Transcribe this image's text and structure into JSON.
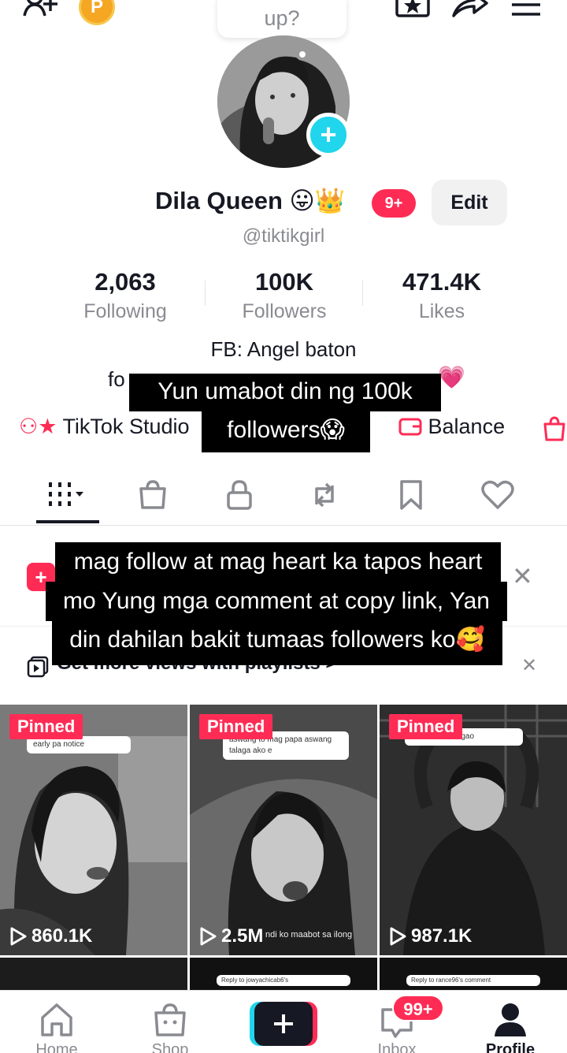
{
  "top": {
    "coin_letter": "P",
    "bubble_text": "up?"
  },
  "profile": {
    "name": "Dila Queen 😛👑",
    "notif_badge": "9+",
    "edit_label": "Edit",
    "handle": "@tiktikgirl"
  },
  "stats": [
    {
      "value": "2,063",
      "label": "Following"
    },
    {
      "value": "100K",
      "label": "Followers"
    },
    {
      "value": "471.4K",
      "label": "Likes"
    }
  ],
  "bio": {
    "line1": "FB: Angel baton",
    "line2_start": "fo",
    "line2_end": "💗"
  },
  "captions": {
    "first": [
      "Yun umabot din ng 100k",
      "followers😱"
    ],
    "second": [
      "mag follow at mag heart ka tapos heart",
      "mo Yung mga comment at copy link, Yan",
      "din dahilan bakit tumaas followers ko🥰"
    ]
  },
  "links": {
    "studio": "TikTok Studio",
    "balance": "Balance"
  },
  "playlist_banner": "Get more views with playlists >",
  "videos": [
    {
      "pinned": "Pinned",
      "views": "860.1K",
      "note": "early pa notice",
      "overlay": ""
    },
    {
      "pinned": "Pinned",
      "views": "2.5M",
      "note": "aswang to mag papa aswang talaga ako e",
      "overlay": "ndi ko maabot sa ilong"
    },
    {
      "pinned": "Pinned",
      "views": "987.1K",
      "note": "ikaw makakangao",
      "overlay": ""
    }
  ],
  "row2_notes": [
    "Reply to jowyachicab6's",
    "Reply to rance96's comment"
  ],
  "bottom_nav": {
    "home": "Home",
    "shop": "Shop",
    "inbox": "Inbox",
    "inbox_badge": "99+",
    "profile": "Profile"
  },
  "colors": {
    "accent": "#fe2c55",
    "cyan": "#20d5ec",
    "text": "#161823",
    "muted": "#8a8b91"
  }
}
